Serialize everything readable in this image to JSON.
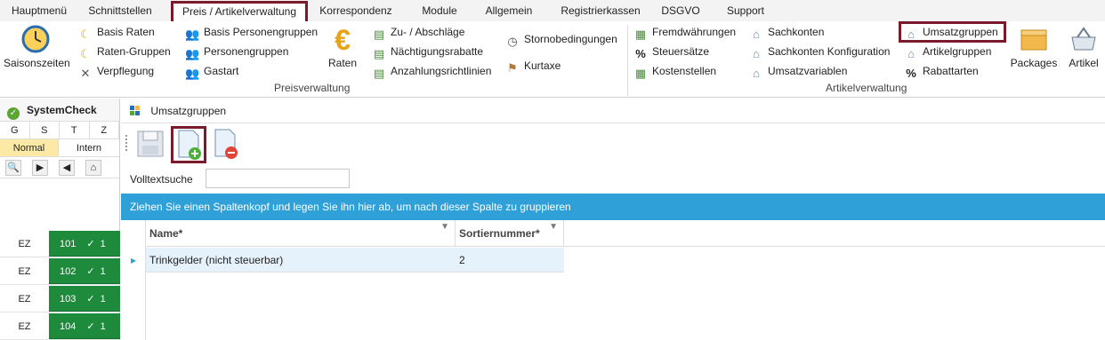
{
  "tabs": [
    "Hauptmenü",
    "Schnittstellen",
    "Preis / Artikelverwaltung",
    "Korrespondenz",
    "Module",
    "Allgemein",
    "Registrierkassen",
    "DSGVO",
    "Support"
  ],
  "ribbon": {
    "saisonszeiten": "Saisonszeiten",
    "col1": [
      "Basis Raten",
      "Raten-Gruppen",
      "Verpflegung"
    ],
    "col2": [
      "Basis Personengruppen",
      "Personengruppen",
      "Gastart"
    ],
    "raten": "Raten",
    "col3": [
      "Zu- / Abschläge",
      "Nächtigungsrabatte",
      "Anzahlungsrichtlinien"
    ],
    "col4": [
      "Stornobedingungen",
      "Kurtaxe"
    ],
    "col5": [
      "Fremdwährungen",
      "Steuersätze",
      "Kostenstellen"
    ],
    "col6": [
      "Sachkonten",
      "Sachkonten Konfiguration",
      "Umsatzvariablen"
    ],
    "col7": [
      "Umsatzgruppen",
      "Artikelgruppen",
      "Rabattarten"
    ],
    "packages": "Packages",
    "artikel": "Artikel",
    "group_preis": "Preisverwaltung",
    "group_artikel": "Artikelverwaltung"
  },
  "left": {
    "title": "SystemCheck",
    "gstz": [
      "G",
      "S",
      "T",
      "Z"
    ],
    "mode_normal": "Normal",
    "mode_intern": "Intern",
    "rooms": [
      {
        "type": "EZ",
        "num": "101",
        "count": "1"
      },
      {
        "type": "EZ",
        "num": "102",
        "count": "1"
      },
      {
        "type": "EZ",
        "num": "103",
        "count": "1"
      },
      {
        "type": "EZ",
        "num": "104",
        "count": "1"
      }
    ]
  },
  "window": {
    "title": "Umsatzgruppen",
    "search_label": "Volltextsuche",
    "search_value": "",
    "group_hint": "Ziehen Sie einen Spaltenkopf und legen Sie ihn hier ab, um nach dieser Spalte zu gruppieren",
    "columns": [
      "Name*",
      "Sortiernummer*"
    ],
    "rows": [
      {
        "name": "Trinkgelder (nicht steuerbar)",
        "sort": "2"
      }
    ]
  },
  "colors": {
    "highlight": "#7a1a2a",
    "groupbar": "#2fa1d8",
    "room_green": "#1e8a3c",
    "normal_yellow": "#fde9a6"
  }
}
